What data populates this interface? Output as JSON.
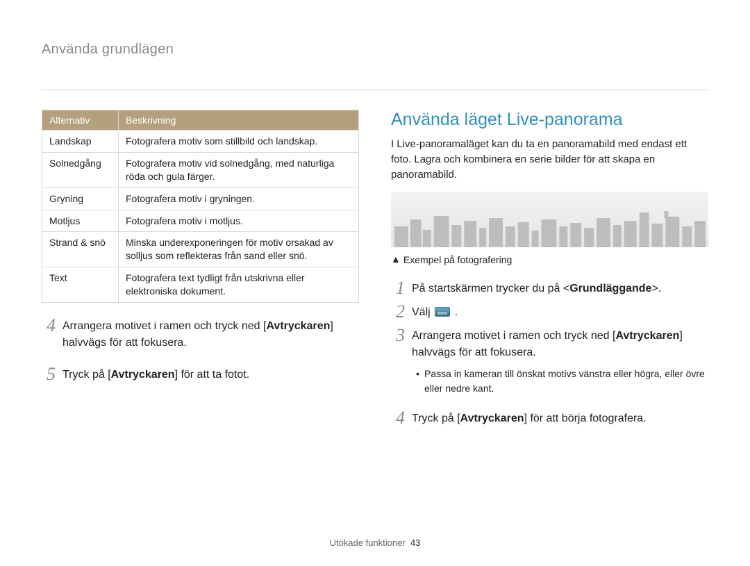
{
  "breadcrumb": "Använda grundlägen",
  "table": {
    "headers": {
      "alt": "Alternativ",
      "desc": "Beskrivning"
    },
    "rows": [
      {
        "alt": "Landskap",
        "desc": "Fotografera motiv som stillbild och landskap."
      },
      {
        "alt": "Solnedgång",
        "desc": "Fotografera motiv vid solnedgång, med naturliga röda och gula färger."
      },
      {
        "alt": "Gryning",
        "desc": "Fotografera motiv i gryningen."
      },
      {
        "alt": "Motljus",
        "desc": "Fotografera motiv i motljus."
      },
      {
        "alt": "Strand & snö",
        "desc": "Minska underexponeringen för motiv orsakad av solljus som reflekteras från sand eller snö."
      },
      {
        "alt": "Text",
        "desc": "Fotografera text tydligt från utskrivna eller elektroniska dokument."
      }
    ]
  },
  "left_steps": {
    "s4": {
      "num": "4",
      "pre": "Arrangera motivet i ramen och tryck ned [",
      "bold": "Avtryckaren",
      "post": "] halvvägs för att fokusera."
    },
    "s5": {
      "num": "5",
      "pre": "Tryck på [",
      "bold": "Avtryckaren",
      "post": "] för att ta fotot."
    }
  },
  "right": {
    "heading": "Använda läget Live-panorama",
    "intro": "I Live-panoramaläget kan du ta en panoramabild med endast ett foto. Lagra och kombinera en serie bilder för att skapa en panoramabild.",
    "caption": "Exempel på fotografering",
    "s1": {
      "num": "1",
      "pre": "På startskärmen trycker du på <",
      "bold": "Grundläggande",
      "post": ">."
    },
    "s2": {
      "num": "2",
      "text": "Välj ",
      "mode_icon_name": "live-panorama-mode-icon",
      "tail": " ."
    },
    "s3": {
      "num": "3",
      "pre": "Arrangera motivet i ramen och tryck ned [",
      "bold": "Avtryckaren",
      "post": "] halvvägs för att fokusera.",
      "bullet": "Passa in kameran till önskat motivs vänstra eller högra, eller övre eller nedre kant."
    },
    "s4": {
      "num": "4",
      "pre": "Tryck på [",
      "bold": "Avtryckaren",
      "post": "] för att börja fotografera."
    }
  },
  "footer": {
    "section": "Utökade funktioner",
    "page": "43"
  }
}
